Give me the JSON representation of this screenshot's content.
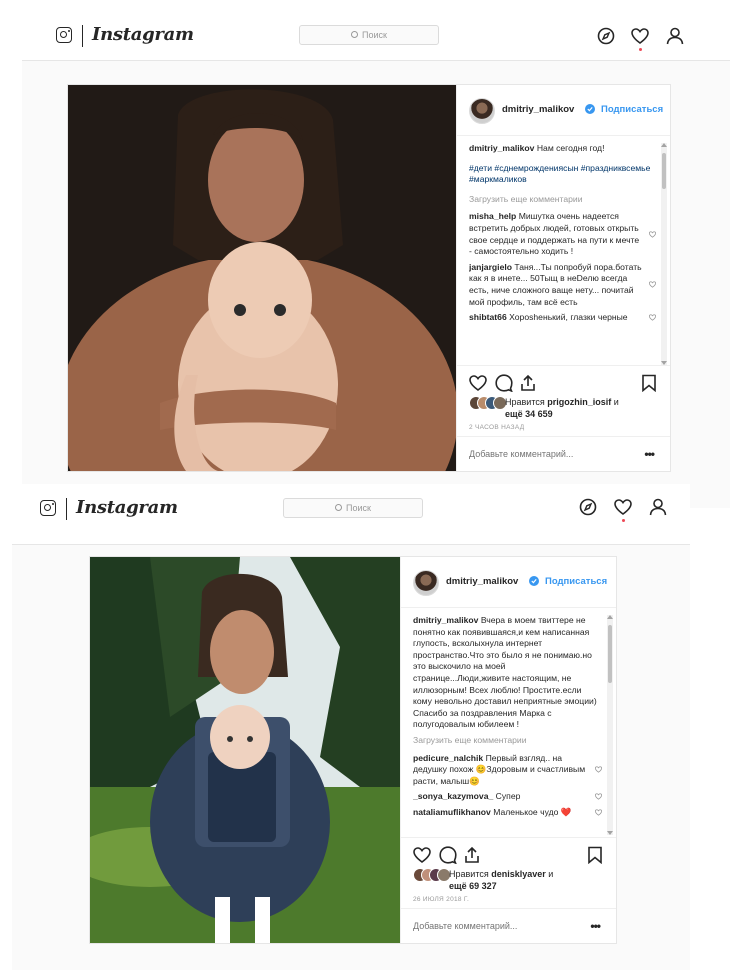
{
  "app": {
    "name": "Instagram"
  },
  "search": {
    "placeholder": "Поиск"
  },
  "posts": [
    {
      "username": "dmitriy_malikov",
      "follow_label": "Подписаться",
      "caption": "Нам сегодня год!",
      "hashtags": "#дети #сднемрождениясын #праздниквсемье #маркмаликов",
      "load_more": "Загрузить еще комментарии",
      "comments": [
        {
          "user": "misha_help",
          "text": "Мишутка очень надеется встретить добрых людей, готовых открыть свое сердце и поддержать на пути к мечте - самостоятельно ходить !"
        },
        {
          "user": "janjargielo",
          "text": "Таня...Ты попробуй пора.ботать как я в инете... 50Тыщ в неDелю всегда есть, ниче сложного ваще нету... почитай мой профиль, там всё есть"
        },
        {
          "user": "shibtat66",
          "text": "Хороshенький, глазки черные"
        }
      ],
      "likes_text": "Нравится",
      "likes_user": "prigozhin_iosif",
      "likes_and": "и",
      "likes_more": "ещё 34 659",
      "timestamp": "2 ЧАСОВ НАЗАД",
      "add_comment_placeholder": "Добавьте комментарий...",
      "more_label": "•••"
    },
    {
      "username": "dmitriy_malikov",
      "follow_label": "Подписаться",
      "caption": "Вчера в моем твиттере не понятно как появившаяся,и кем написанная глупость, всколыхнула интернет пространство.Что это было я не понимаю.но это выскочило на моей странице...Люди,живите настоящим, не иллюзорным! Всех люблю! Простите.если кому невольно доставил неприятные эмоции) Спасибо за поздравления Марка с полугодовалым юбилеем !",
      "load_more": "Загрузить еще комментарии",
      "comments": [
        {
          "user": "pedicure_nalchik",
          "text": "Первый взгляд.. на дедушку похож 😊Здоровым и счастливым расти, малыш😊"
        },
        {
          "user": "_sonya_kazymova_",
          "text": "Супер"
        },
        {
          "user": "nataliamuflikhanov",
          "text": "Маленькое чудо ❤️"
        }
      ],
      "likes_text": "Нравится",
      "likes_user": "denisklyaver",
      "likes_and": "и",
      "likes_more": "ещё 69 327",
      "timestamp": "26 ИЮЛЯ 2018 Г.",
      "add_comment_placeholder": "Добавьте комментарий...",
      "more_label": "•••"
    }
  ],
  "colors": {
    "link": "#3897f0",
    "hashtag": "#003569",
    "muted": "#999999",
    "notification": "#ed4956"
  },
  "icons": [
    "instagram-glyph-icon",
    "search-icon",
    "compass-icon",
    "heart-icon",
    "user-icon",
    "verified-badge-icon",
    "comment-icon",
    "share-icon",
    "bookmark-icon",
    "more-options-icon"
  ]
}
